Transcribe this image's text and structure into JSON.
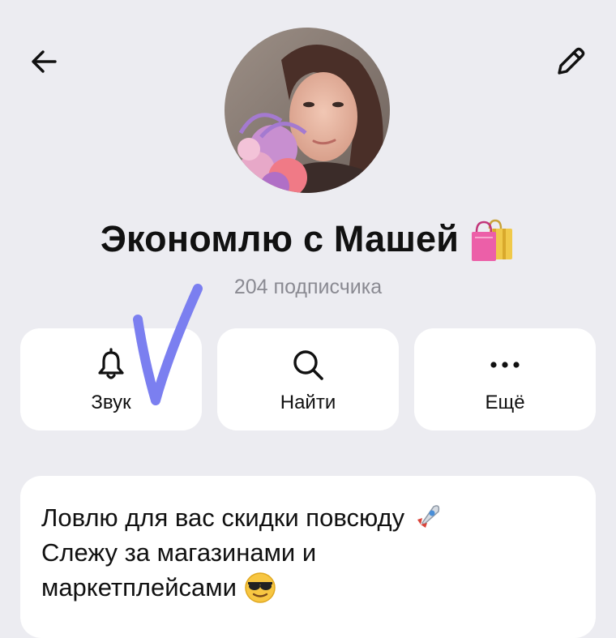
{
  "header": {
    "back_icon": "arrow-left-icon",
    "edit_icon": "pencil-icon"
  },
  "profile": {
    "name": "Экономлю с Машей",
    "name_emoji": "shopping-bags-emoji",
    "subscribers": "204 подписчика"
  },
  "actions": [
    {
      "label": "Звук",
      "icon": "bell-icon"
    },
    {
      "label": "Найти",
      "icon": "search-icon"
    },
    {
      "label": "Ещё",
      "icon": "more-dots-icon"
    }
  ],
  "annotation": {
    "mark": "checkmark-drawing",
    "color": "#7b7ff0"
  },
  "description": {
    "line1": "Ловлю для вас скидки повсюду",
    "line1_emoji": "rocket-emoji",
    "line2": "Слежу за магазинами и",
    "line3": "маркетплейсами",
    "line3_emoji": "sunglasses-face-emoji"
  },
  "colors": {
    "background": "#ececf1",
    "card": "#ffffff",
    "text": "#111111",
    "muted": "#8a8a92"
  }
}
